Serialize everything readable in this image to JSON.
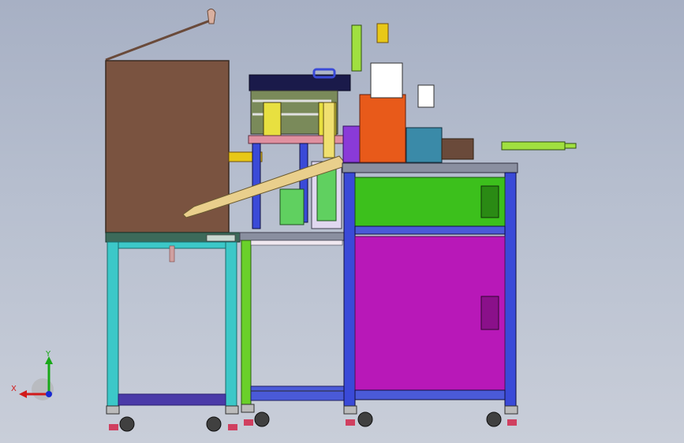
{
  "viewport": {
    "background_top": "#a7b0c4",
    "background_bottom": "#c9ced9"
  },
  "triad": {
    "x_label": "X",
    "y_label": "Y",
    "x_color": "#d11a1a",
    "y_color": "#18a818",
    "z_color": "#1a2ad1"
  },
  "colors": {
    "hopper": "#7a5340",
    "left_table": "#3cc8c8",
    "cabinet_green": "#3cc01c",
    "cabinet_magenta": "#b818b8",
    "frame_blue": "#3a4ad8",
    "top_plate": "#8a8fa0",
    "orange_block": "#e85a1a",
    "chute": "#e9cf8c",
    "violet_block": "#8a3ad8"
  }
}
